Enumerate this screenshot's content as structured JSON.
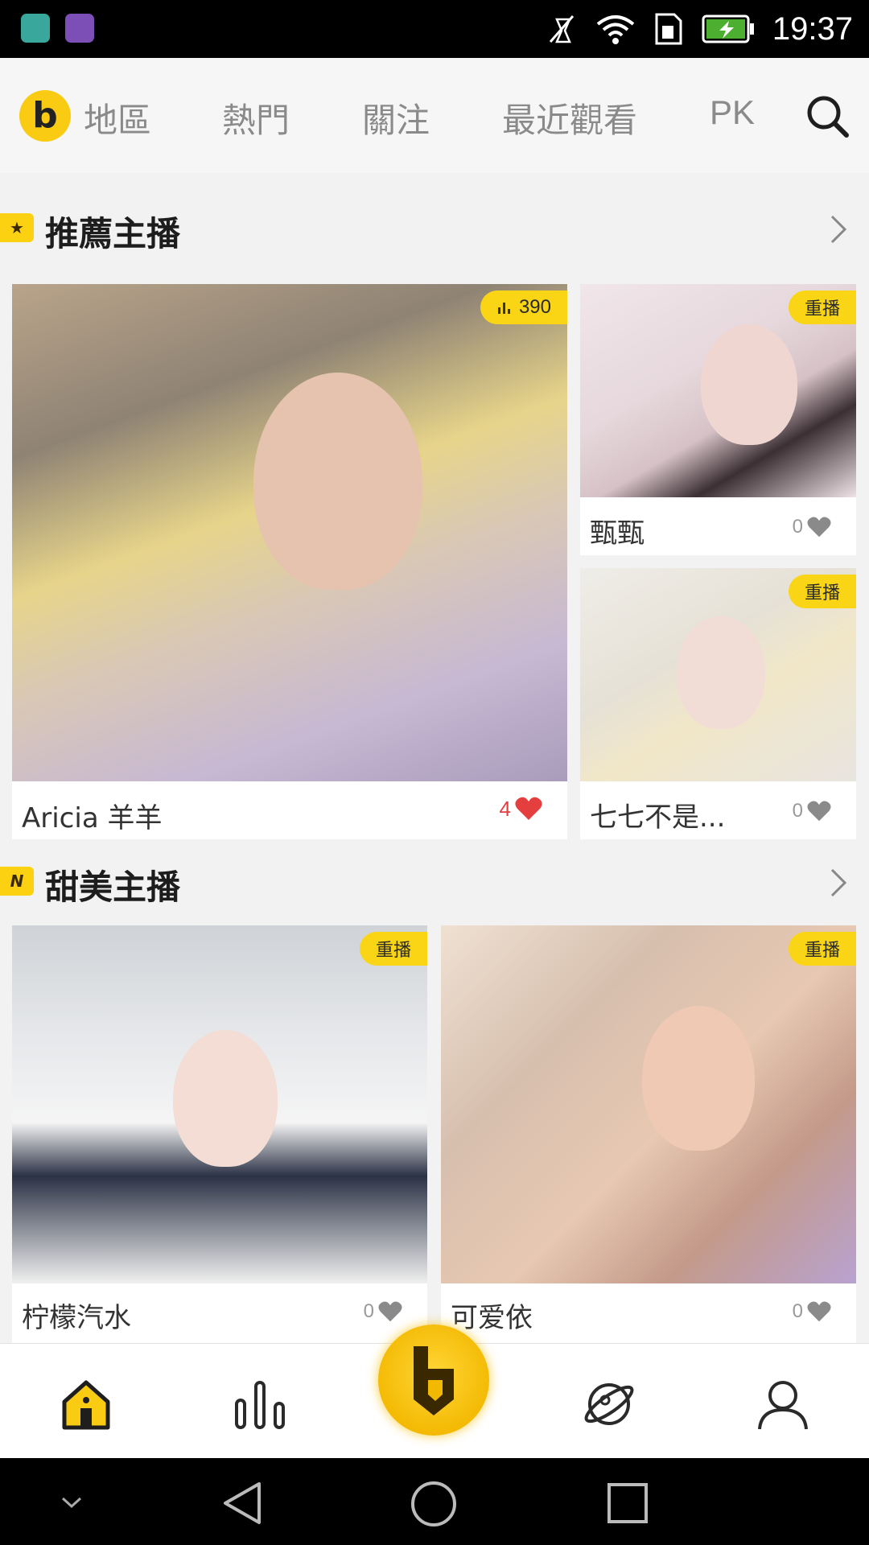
{
  "status_bar": {
    "time": "19:37",
    "icons": [
      "android-debug-icon",
      "gallery-icon",
      "mute-icon",
      "wifi-icon",
      "sim-icon",
      "battery-charging-icon"
    ]
  },
  "top_nav": {
    "logo_letter": "b",
    "tabs": [
      {
        "label": "地區",
        "active": true
      },
      {
        "label": "熱門"
      },
      {
        "label": "關注"
      },
      {
        "label": "最近觀看"
      },
      {
        "label": "PK"
      }
    ],
    "search_icon": "search-icon"
  },
  "sections": [
    {
      "title": "推薦主播",
      "badge": "★",
      "cards": [
        {
          "name": "Aricia 羊羊",
          "likes": "4",
          "tag": "390",
          "tag_icon": "bar-chart-icon"
        },
        {
          "name": "甄甄",
          "likes": "0",
          "tag": "重播"
        },
        {
          "name": "七七不是...",
          "likes": "0",
          "tag": "重播"
        }
      ]
    },
    {
      "title": "甜美主播",
      "badge": "N",
      "cards": [
        {
          "name": "柠檬汽水",
          "likes": "0",
          "tag": "重播"
        },
        {
          "name": "可爱依",
          "likes": "0",
          "tag": "重播"
        }
      ]
    }
  ],
  "bottom_nav": {
    "items": [
      "home-icon",
      "ranking-icon",
      "live-center-icon",
      "explore-planet-icon",
      "profile-icon"
    ],
    "center_letter": "b"
  },
  "colors": {
    "accent": "#f9cb12",
    "heart_red": "#e53e3e",
    "heart_gray": "#8a8a8a"
  }
}
